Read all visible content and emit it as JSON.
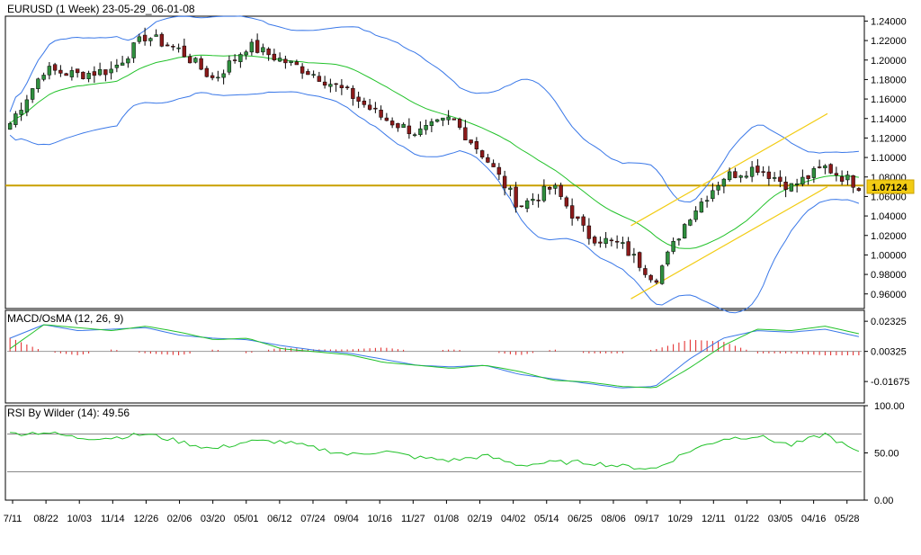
{
  "header": {
    "title": "EURUSD (1 Week) 23-05-29_06-01-08"
  },
  "price_panel": {
    "current_price": "1.07124",
    "y_ticks": [
      "1.24000",
      "1.22000",
      "1.20000",
      "1.18000",
      "1.16000",
      "1.14000",
      "1.12000",
      "1.10000",
      "1.08000",
      "1.06000",
      "1.04000",
      "1.02000",
      "1.00000",
      "0.98000",
      "0.96000"
    ],
    "colors": {
      "bollinger": "#3a78e8",
      "sma": "#22c22a",
      "channel": "#f2cc14",
      "price_line": "#c9a000",
      "bull": "#2f8f3e",
      "bear": "#8b1a1a"
    }
  },
  "macd_panel": {
    "label": "MACD/OsMA (12, 26, 9)",
    "y_ticks": [
      "0.02325",
      "0.00325",
      "-0.01675"
    ],
    "colors": {
      "macd": "#3a78e8",
      "signal": "#22c22a",
      "osma": "#e02020"
    }
  },
  "rsi_panel": {
    "label": "RSI By Wilder (14): 49.56",
    "y_ticks": [
      "100.00",
      "50.00",
      "0.00"
    ],
    "colors": {
      "rsi": "#22c22a"
    }
  },
  "x_axis": {
    "labels": [
      "7/11",
      "08/22",
      "10/03",
      "11/14",
      "12/26",
      "02/06",
      "03/20",
      "05/01",
      "06/12",
      "07/24",
      "09/04",
      "10/16",
      "11/27",
      "01/08",
      "02/19",
      "04/02",
      "05/14",
      "06/25",
      "08/06",
      "09/17",
      "10/29",
      "12/11",
      "01/22",
      "03/05",
      "04/16",
      "05/28"
    ]
  },
  "chart_data": [
    {
      "type": "candlestick",
      "title": "EURUSD (1 Week) 23-05-29_06-01-08",
      "ylim": [
        0.945,
        1.245
      ],
      "x_labels": [
        "7/11",
        "08/22",
        "10/03",
        "11/14",
        "12/26",
        "02/06",
        "03/20",
        "05/01",
        "06/12",
        "07/24",
        "09/04",
        "10/16",
        "11/27",
        "01/08",
        "02/19",
        "04/02",
        "05/14",
        "06/25",
        "08/06",
        "09/17",
        "10/29",
        "12/11",
        "01/22",
        "03/05",
        "04/16",
        "05/28"
      ],
      "close_anchors": [
        1.135,
        1.19,
        1.185,
        1.19,
        1.225,
        1.21,
        1.18,
        1.215,
        1.2,
        1.185,
        1.165,
        1.14,
        1.125,
        1.14,
        1.1,
        1.05,
        1.07,
        1.02,
        1.01,
        0.975,
        1.04,
        1.08,
        1.09,
        1.07,
        1.09,
        1.07124
      ],
      "current_price": 1.07124,
      "channel_upper": [
        [
          0.962,
          1.03
        ],
        [
          0.99,
          1.145
        ]
      ],
      "channel_lower": [
        [
          0.962,
          0.955
        ],
        [
          0.99,
          1.07
        ]
      ]
    },
    {
      "type": "line",
      "title": "MACD/OsMA (12, 26, 9)",
      "ylim": [
        -0.031,
        0.0305
      ],
      "series": [
        {
          "name": "MACD",
          "values": [
            0.012,
            0.021,
            0.017,
            0.018,
            0.019,
            0.014,
            0.012,
            0.011,
            0.007,
            0.004,
            0.002,
            -0.002,
            -0.006,
            -0.007,
            -0.006,
            -0.012,
            -0.015,
            -0.018,
            -0.021,
            -0.02,
            -0.002,
            0.012,
            0.017,
            0.016,
            0.018,
            0.013
          ]
        },
        {
          "name": "Signal",
          "values": [
            0.005,
            0.021,
            0.019,
            0.017,
            0.02,
            0.016,
            0.011,
            0.012,
            0.005,
            0.003,
            0.001,
            -0.004,
            -0.006,
            -0.008,
            -0.006,
            -0.01,
            -0.016,
            -0.017,
            -0.02,
            -0.021,
            -0.008,
            0.007,
            0.018,
            0.017,
            0.02,
            0.015
          ]
        }
      ]
    },
    {
      "type": "line",
      "title": "RSI By Wilder (14): 49.56",
      "ylim": [
        0,
        100
      ],
      "series": [
        {
          "name": "RSI",
          "values": [
            70,
            72,
            66,
            66,
            70,
            62,
            54,
            62,
            62,
            55,
            48,
            52,
            45,
            42,
            47,
            37,
            40,
            40,
            36,
            33,
            52,
            65,
            68,
            58,
            70,
            49.56
          ]
        }
      ]
    }
  ]
}
